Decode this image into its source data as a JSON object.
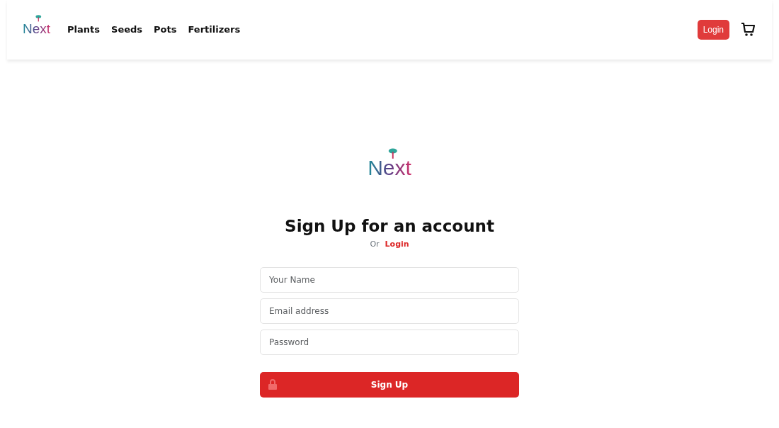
{
  "navbar": {
    "logo": "Next",
    "links": [
      {
        "label": "Plants"
      },
      {
        "label": "Seeds"
      },
      {
        "label": "Pots"
      },
      {
        "label": "Fertilizers"
      }
    ],
    "login_button": "Login"
  },
  "form": {
    "logo": "Next",
    "title": "Sign Up for an account",
    "or_text": "Or",
    "login_link": "Login",
    "fields": [
      {
        "placeholder": "Your Name"
      },
      {
        "placeholder": "Email address"
      },
      {
        "placeholder": "Password"
      }
    ],
    "submit": "Sign Up"
  }
}
